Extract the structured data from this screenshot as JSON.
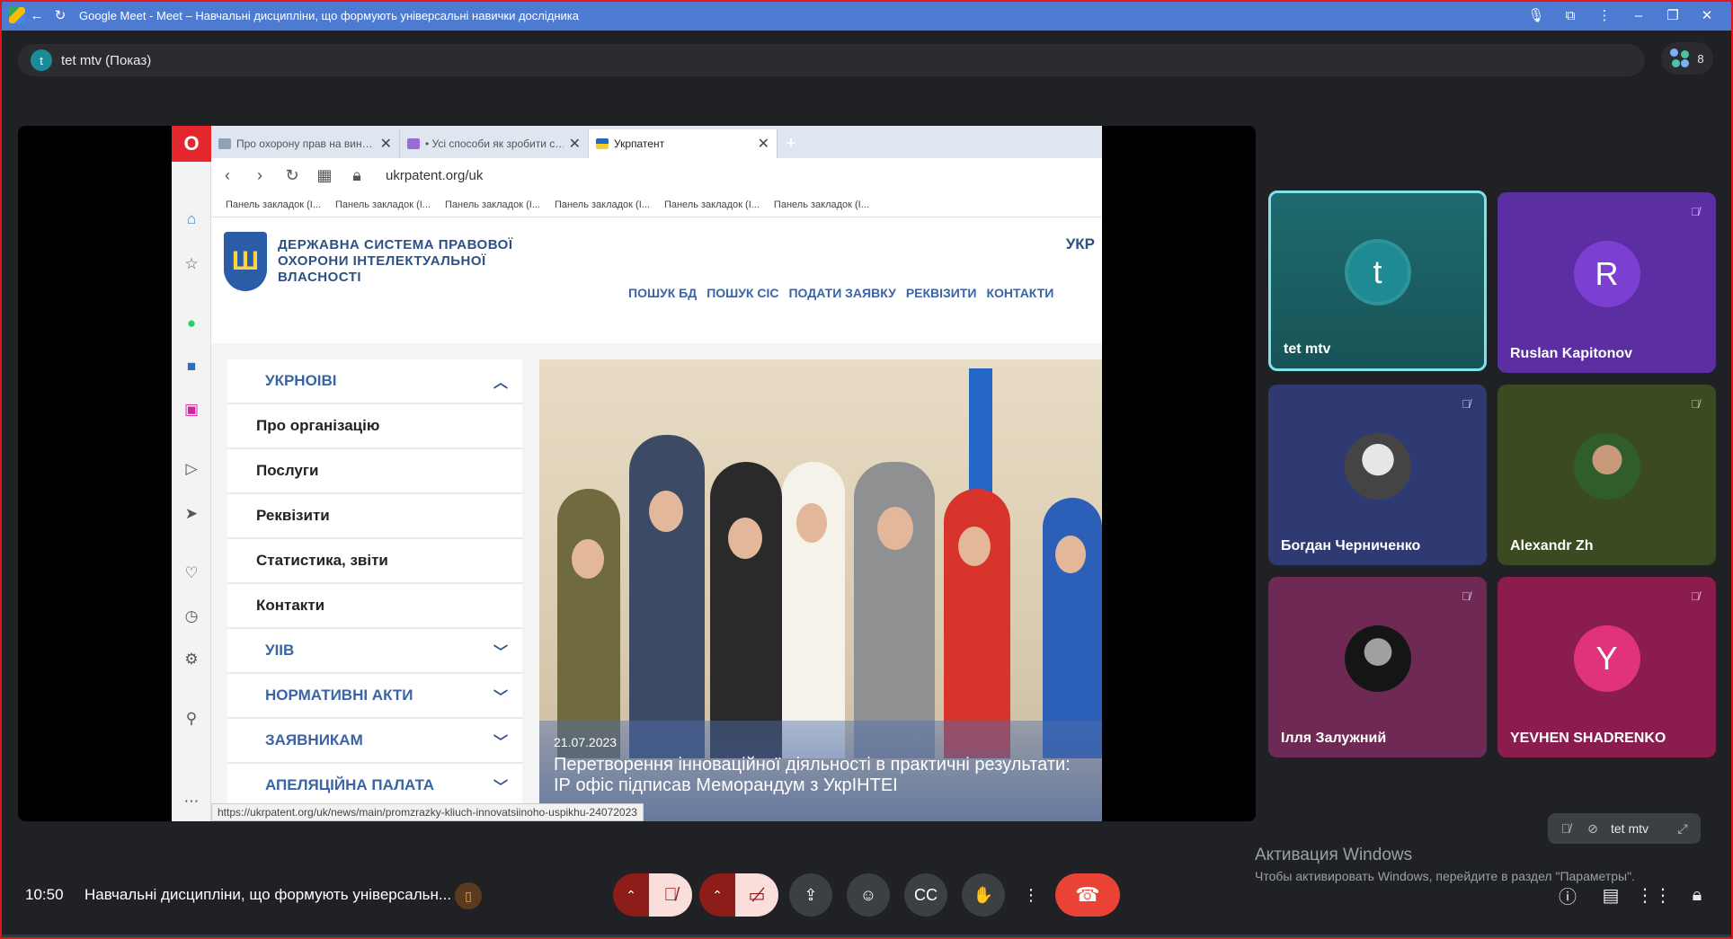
{
  "window": {
    "title": "Google Meet - Meet – Навчальні дисципліни, що формують універсальні навички дослідника"
  },
  "presenter": {
    "initial": "t",
    "label": "tet mtv (Показ)"
  },
  "participants_count": "8",
  "shared_browser": {
    "tabs": [
      {
        "label": "Про охорону прав на вин…"
      },
      {
        "label": "• Усі способи як зробити с…"
      },
      {
        "label": "Укрпатент"
      }
    ],
    "url": "ukrpatent.org/uk",
    "bookmarks": [
      "Панель закладок (І...",
      "Панель закладок (І...",
      "Панель закладок (І...",
      "Панель закладок (І...",
      "Панель закладок (І...",
      "Панель закладок (І..."
    ],
    "site": {
      "name": "ДЕРЖАВНА СИСТЕМА ПРАВОВОЇ ОХОРОНИ ІНТЕЛЕКТУАЛЬНОЇ ВЛАСНОСТІ",
      "lang": "УКР",
      "nav": [
        "ПОШУК БД",
        "ПОШУК СІС",
        "ПОДАТИ ЗАЯВКУ",
        "РЕКВІЗИТИ",
        "КОНТАКТИ"
      ],
      "menu_header": "УКРНОІВІ",
      "menu": [
        "Про організацію",
        "Послуги",
        "Реквізити",
        "Статистика, звіти",
        "Контакти"
      ],
      "menu_sections": [
        "УІІВ",
        "НОРМАТИВНІ АКТИ",
        "ЗАЯВНИКАМ",
        "АПЕЛЯЦІЙНА ПАЛАТА"
      ],
      "news_date": "21.07.2023",
      "news_title": "Перетворення інноваційної діяльності в практичні результати: ІР офіс підписав Меморандум з УкрІНТЕІ"
    },
    "status_url": "https://ukrpatent.org/uk/news/main/promzrazky-kliuch-innovatsiinoho-uspikhu-24072023"
  },
  "tiles": [
    {
      "name": "tet mtv",
      "initial": "t",
      "color": "#1e8a92",
      "bg": "#1c5b5e",
      "muted": false,
      "active": true
    },
    {
      "name": "Ruslan Kapitonov",
      "initial": "R",
      "color": "#7b3fd1",
      "bg": "#5a2e9c",
      "muted": true,
      "active": false
    },
    {
      "name": "Богдан Черниченко",
      "initial": "",
      "color": "#555",
      "bg": "#2f3a72",
      "muted": true,
      "active": false
    },
    {
      "name": "Alexandr Zh",
      "initial": "",
      "color": "#555",
      "bg": "#3b4a20",
      "muted": true,
      "active": false
    },
    {
      "name": "Ілля Залужний",
      "initial": "",
      "color": "#222",
      "bg": "#6e2a55",
      "muted": true,
      "active": false
    },
    {
      "name": "YEVHEN SHADRENKO",
      "initial": "Y",
      "color": "#e0337c",
      "bg": "#8a1d4e",
      "muted": true,
      "active": false
    }
  ],
  "selfview": {
    "name": "tet mtv"
  },
  "activation": {
    "title": "Активация Windows",
    "subtitle": "Чтобы активировать Windows, перейдите в раздел \"Параметры\"."
  },
  "bottom": {
    "time": "10:50",
    "meeting_title": "Навчальні дисципліни, що формують універсальн..."
  }
}
